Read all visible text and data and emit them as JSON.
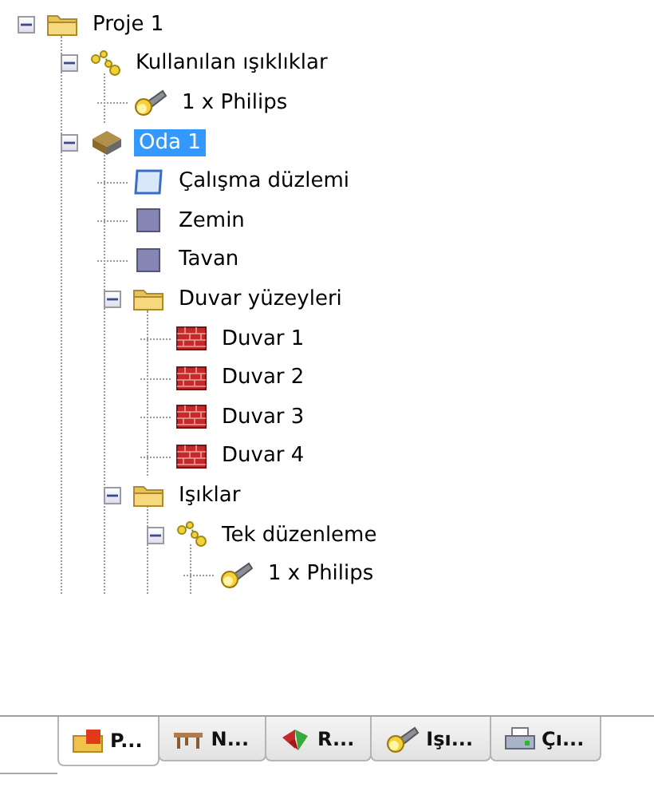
{
  "tree": [
    {
      "label": "Proje 1",
      "kind": "folder",
      "expanded": true,
      "selected": false,
      "children": [
        {
          "label": "Kullanılan ışıklıklar",
          "kind": "group",
          "expanded": true,
          "selected": false,
          "children": [
            {
              "label": "1 x Philips",
              "kind": "lamp",
              "selected": false
            }
          ]
        },
        {
          "label": "Oda 1",
          "kind": "room",
          "expanded": true,
          "selected": true,
          "children": [
            {
              "label": "Çalışma düzlemi",
              "kind": "plane",
              "selected": false
            },
            {
              "label": "Zemin",
              "kind": "surface",
              "selected": false
            },
            {
              "label": "Tavan",
              "kind": "surface",
              "selected": false
            },
            {
              "label": "Duvar yüzeyleri",
              "kind": "folder",
              "expanded": true,
              "selected": false,
              "children": [
                {
                  "label": "Duvar 1",
                  "kind": "wall",
                  "selected": false
                },
                {
                  "label": "Duvar 2",
                  "kind": "wall",
                  "selected": false
                },
                {
                  "label": "Duvar 3",
                  "kind": "wall",
                  "selected": false
                },
                {
                  "label": "Duvar 4",
                  "kind": "wall",
                  "selected": false
                }
              ]
            },
            {
              "label": "Işıklar",
              "kind": "folder",
              "expanded": true,
              "selected": false,
              "children": [
                {
                  "label": "Tek düzenleme",
                  "kind": "group",
                  "expanded": true,
                  "selected": false,
                  "children": [
                    {
                      "label": "1 x Philips",
                      "kind": "lamp",
                      "selected": false
                    }
                  ]
                }
              ]
            }
          ]
        }
      ]
    }
  ],
  "tabs": [
    {
      "label": "P...",
      "kind": "project",
      "selected": true
    },
    {
      "label": "N...",
      "kind": "table",
      "selected": false
    },
    {
      "label": "R...",
      "kind": "leaf",
      "selected": false
    },
    {
      "label": "Işı...",
      "kind": "lamp",
      "selected": false
    },
    {
      "label": "Çı...",
      "kind": "printer",
      "selected": false
    }
  ]
}
